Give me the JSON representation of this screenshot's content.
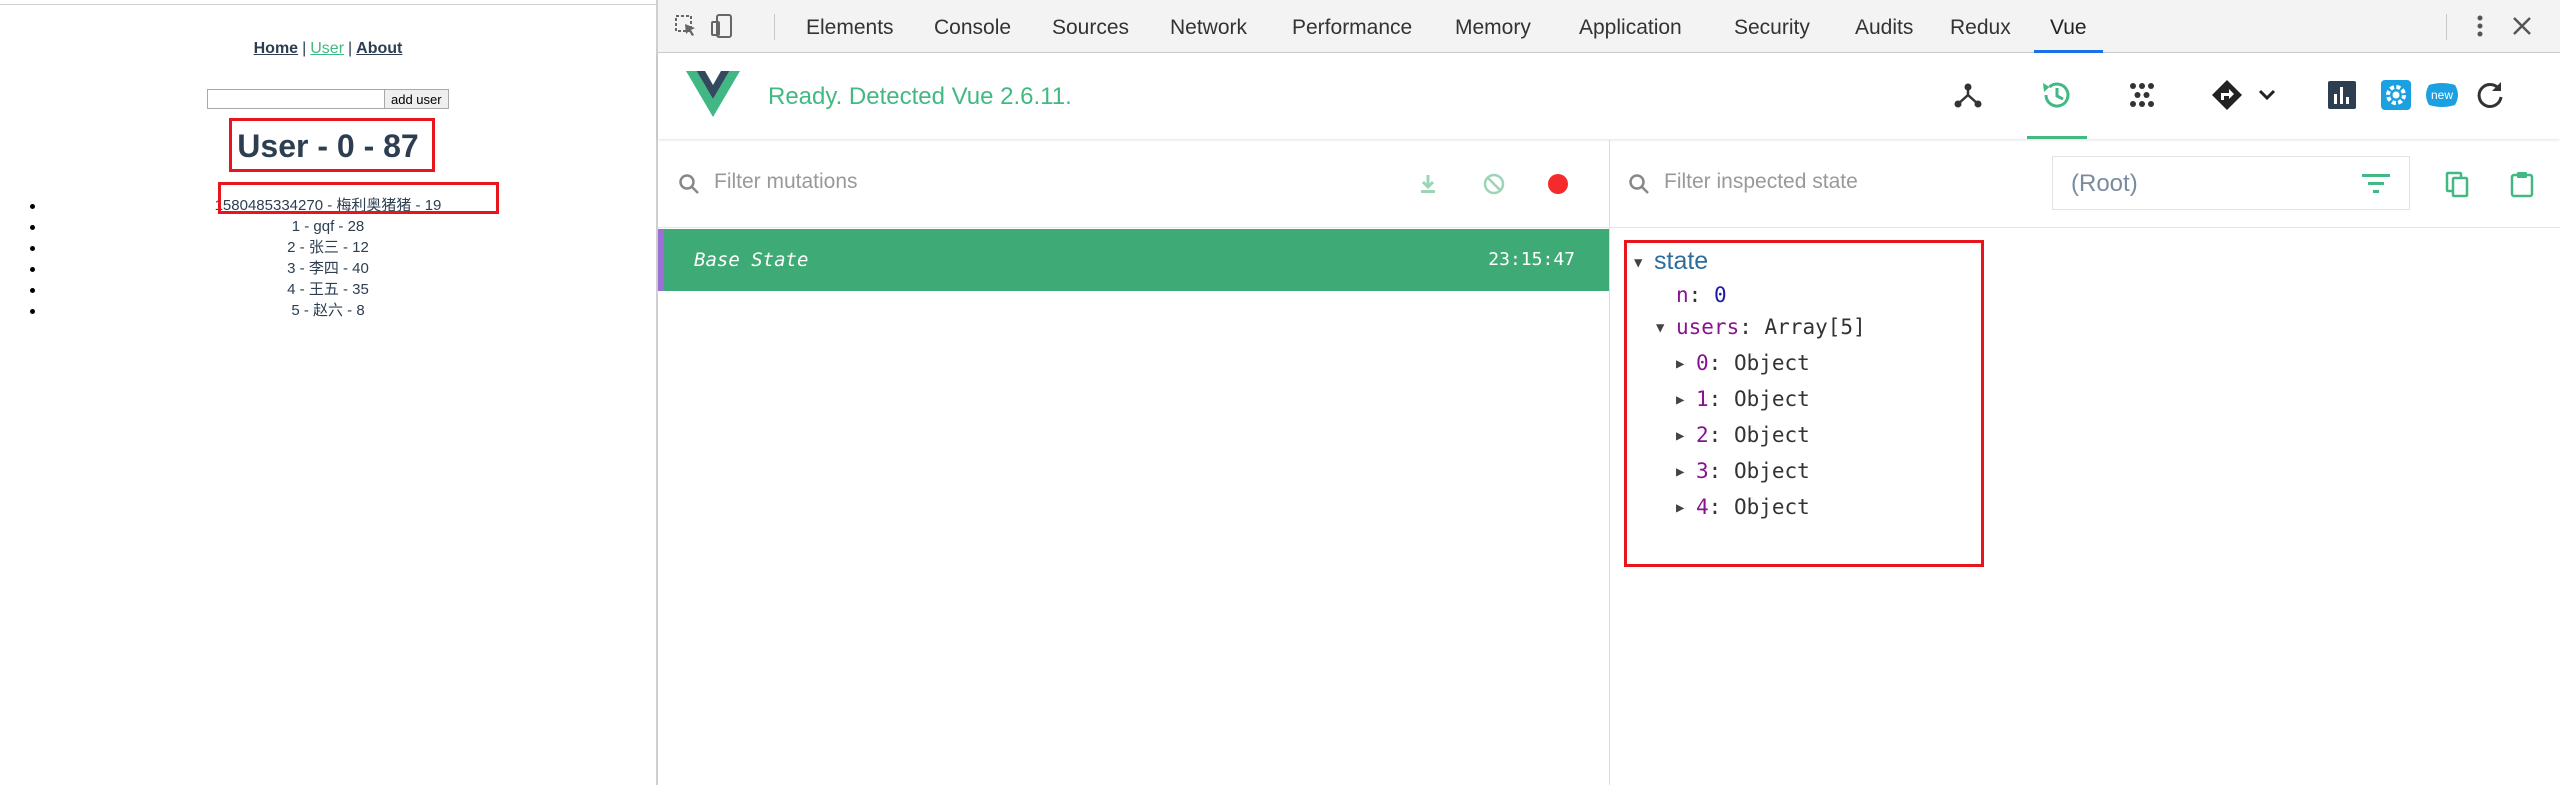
{
  "app": {
    "nav": {
      "home": "Home",
      "sep1": "|",
      "user": "User",
      "sep2": "|",
      "about": "About"
    },
    "input_value": "",
    "add_button": "add user",
    "title": "User - 0 - 87",
    "users": [
      "1580485334270 - 梅利奥猪猪 - 19",
      "1 - gqf - 28",
      "2 - 张三 - 12",
      "3 - 李四 - 40",
      "4 - 王五 - 35",
      "5 - 赵六 - 8"
    ]
  },
  "devtools": {
    "tabs": [
      "Elements",
      "Console",
      "Sources",
      "Network",
      "Performance",
      "Memory",
      "Application",
      "Security",
      "Audits",
      "Redux",
      "Vue"
    ],
    "active_tab": "Vue",
    "vue_status": "Ready. Detected Vue 2.6.11.",
    "new_badge": "new",
    "filter_mutations_placeholder": "Filter mutations",
    "filter_state_placeholder": "Filter inspected state",
    "root_select": "(Root)",
    "mutation": {
      "name": "Base State",
      "time": "23:15:47"
    },
    "state": {
      "label": "state",
      "n_key": "n",
      "n_value": "0",
      "users_key": "users",
      "users_type": "Array[5]",
      "items": [
        {
          "key": "0",
          "type": "Object"
        },
        {
          "key": "1",
          "type": "Object"
        },
        {
          "key": "2",
          "type": "Object"
        },
        {
          "key": "3",
          "type": "Object"
        },
        {
          "key": "4",
          "type": "Object"
        }
      ]
    }
  },
  "colors": {
    "vue_green": "#42b983",
    "mutation_bg": "#3eaa75",
    "highlight_red": "#e8141e",
    "record_red": "#f52a2a",
    "active_tab_blue": "#1a73e8"
  }
}
